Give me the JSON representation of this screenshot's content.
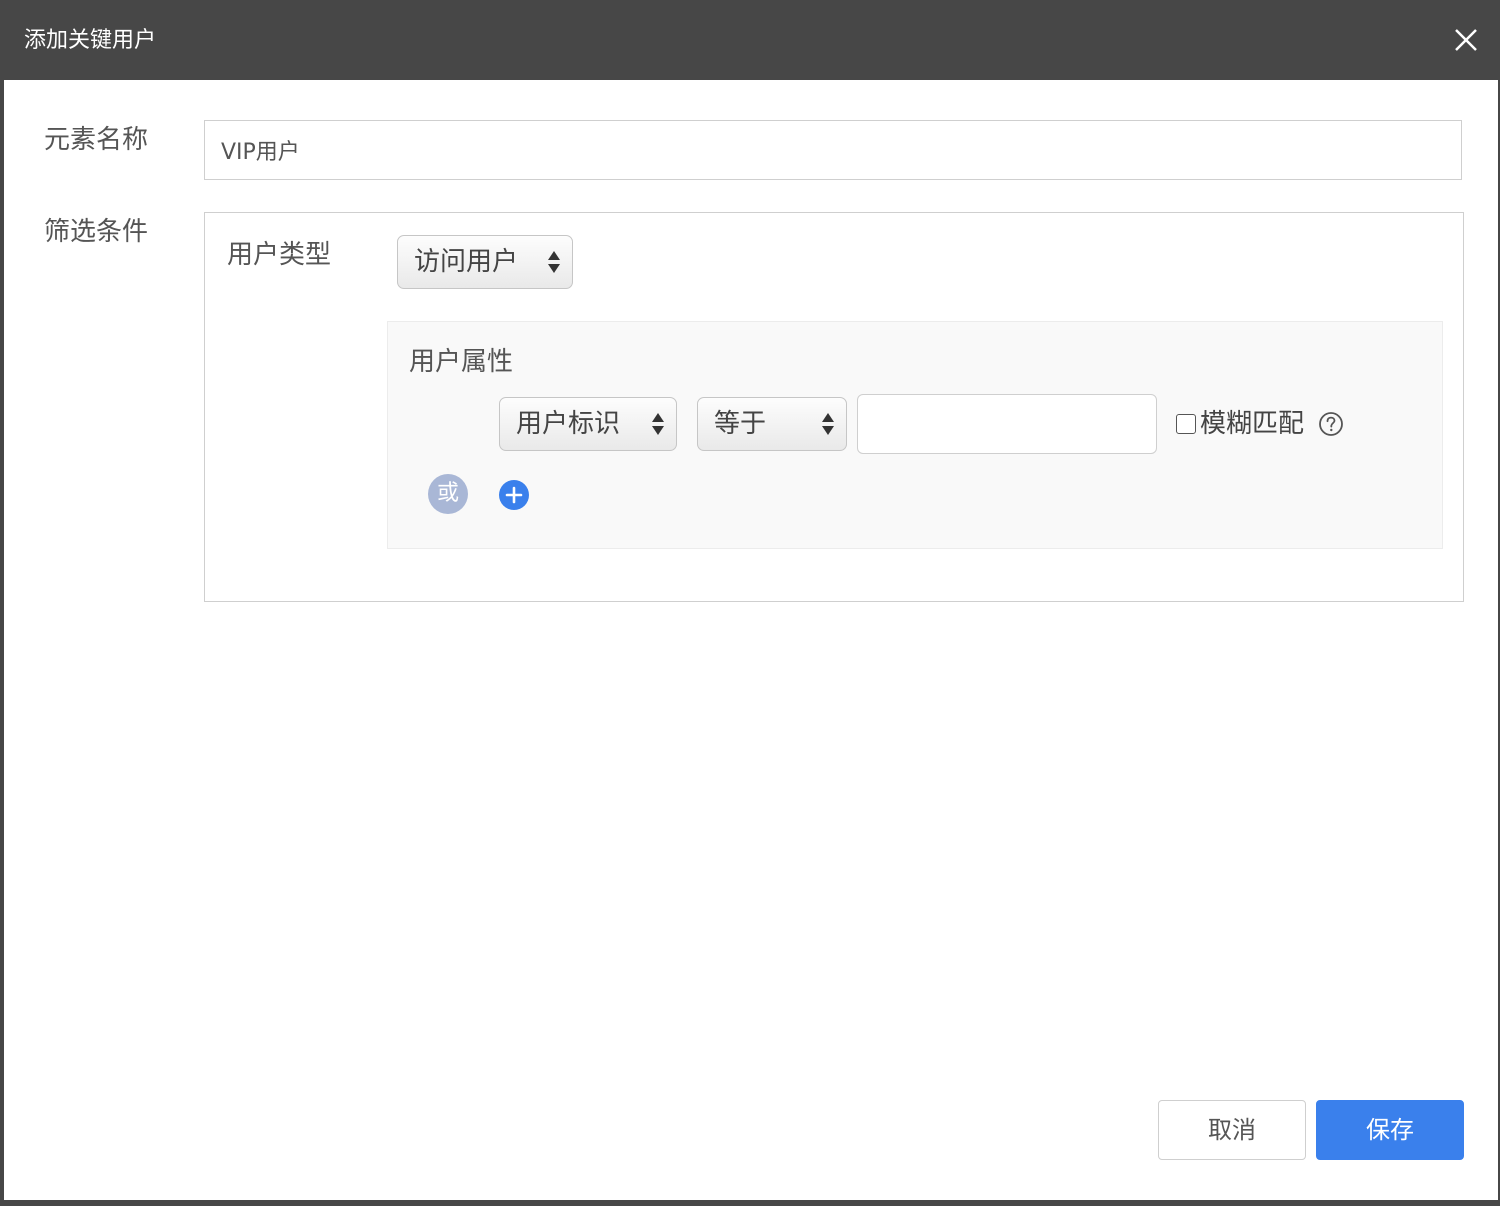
{
  "dialog": {
    "title": "添加关键用户",
    "close_icon": "close-icon"
  },
  "form": {
    "element_name_label": "元素名称",
    "element_name_value": "VIP用户",
    "filter_label": "筛选条件"
  },
  "filter": {
    "user_type_label": "用户类型",
    "user_type_selected": "访问用户",
    "attribute_section_label": "用户属性",
    "attribute_field_selected": "用户标识",
    "operator_selected": "等于",
    "value": "",
    "fuzzy_match_label": "模糊匹配",
    "fuzzy_match_checked": false,
    "or_label": "或",
    "help_icon": "help-icon",
    "add_icon": "add-icon"
  },
  "footer": {
    "cancel_label": "取消",
    "save_label": "保存"
  },
  "colors": {
    "titlebar": "#474747",
    "primary": "#3a80ec",
    "or_badge": "#a9b7d6"
  }
}
